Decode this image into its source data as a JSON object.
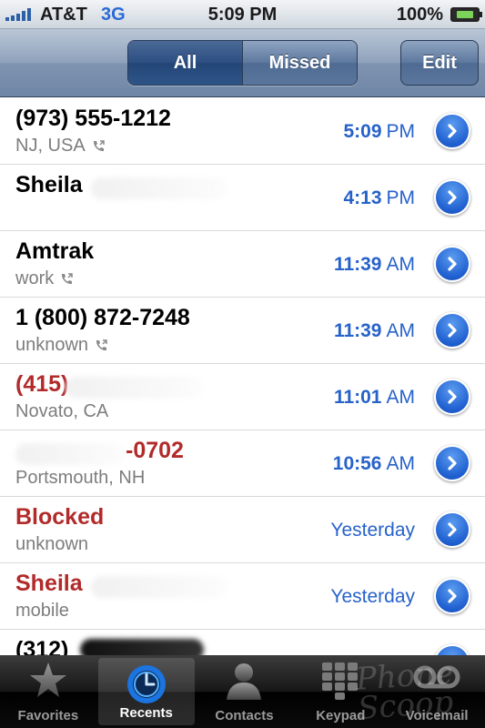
{
  "status_bar": {
    "carrier": "AT&T",
    "network": "3G",
    "time": "5:09 PM",
    "battery": "100%",
    "signal_bars": 5
  },
  "nav": {
    "segments": [
      "All",
      "Missed"
    ],
    "selected_segment": "All",
    "edit_label": "Edit"
  },
  "calls": [
    {
      "name": "(973) 555-1212",
      "detail": "NJ, USA",
      "time": "5:09",
      "ampm": "PM",
      "missed": false,
      "call_icon": true
    },
    {
      "name": "Sheila",
      "detail": "",
      "time": "4:13",
      "ampm": "PM",
      "missed": false,
      "call_icon": false
    },
    {
      "name": "Amtrak",
      "detail": "work",
      "time": "11:39",
      "ampm": "AM",
      "missed": false,
      "call_icon": true
    },
    {
      "name": "1 (800) 872-7248",
      "detail": "unknown",
      "time": "11:39",
      "ampm": "AM",
      "missed": false,
      "call_icon": true
    },
    {
      "name": "(415)",
      "detail": "Novato, CA",
      "time": "11:01",
      "ampm": "AM",
      "missed": true,
      "call_icon": false
    },
    {
      "name": "-0702",
      "detail": "Portsmouth, NH",
      "time": "10:56",
      "ampm": "AM",
      "missed": true,
      "call_icon": false
    },
    {
      "name": "Blocked",
      "detail": "unknown",
      "time": "Yesterday",
      "ampm": "",
      "missed": true,
      "call_icon": false
    },
    {
      "name": "Sheila",
      "detail": "mobile",
      "time": "Yesterday",
      "ampm": "",
      "missed": true,
      "call_icon": false
    },
    {
      "name": "(312)",
      "detail": "",
      "time": "",
      "ampm": "",
      "missed": false,
      "call_icon": false
    }
  ],
  "tabs": [
    {
      "label": "Favorites",
      "icon": "star-icon",
      "active": false
    },
    {
      "label": "Recents",
      "icon": "clock-icon",
      "active": true
    },
    {
      "label": "Contacts",
      "icon": "person-icon",
      "active": false
    },
    {
      "label": "Keypad",
      "icon": "keypad-icon",
      "active": false
    },
    {
      "label": "Voicemail",
      "icon": "voicemail-icon",
      "active": false
    }
  ],
  "watermark": "Phone Scoop",
  "colors": {
    "missed": "#b22a2a",
    "time_blue": "#2762c9",
    "nav_blue": "#2c4e82"
  }
}
